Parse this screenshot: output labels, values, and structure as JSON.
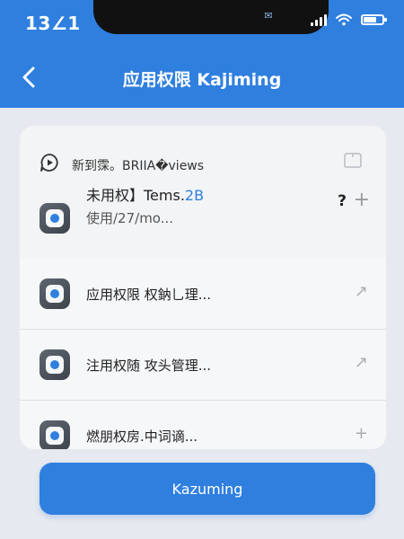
{
  "status_bar": {
    "time": "13∠1",
    "battery_level": 0.7
  },
  "nav": {
    "title": "应用权限 Kajiming"
  },
  "header": {
    "label": "新到霂。BRIIA�views",
    "app_name": "未用权】Tems.",
    "app_name_accent": "2B",
    "sub": "使用/27/mo...",
    "help": "?",
    "action": "+"
  },
  "rows": [
    {
      "label": "应用权限 权鈉乚理...",
      "action": "↗"
    },
    {
      "label": "注用权随 攻头管理...",
      "action": "↗"
    },
    {
      "label": "燃朋权房.中词谪...",
      "action": "+"
    }
  ],
  "button": {
    "label": "Kazuming"
  },
  "colors": {
    "primary": "#2f7fdf"
  }
}
